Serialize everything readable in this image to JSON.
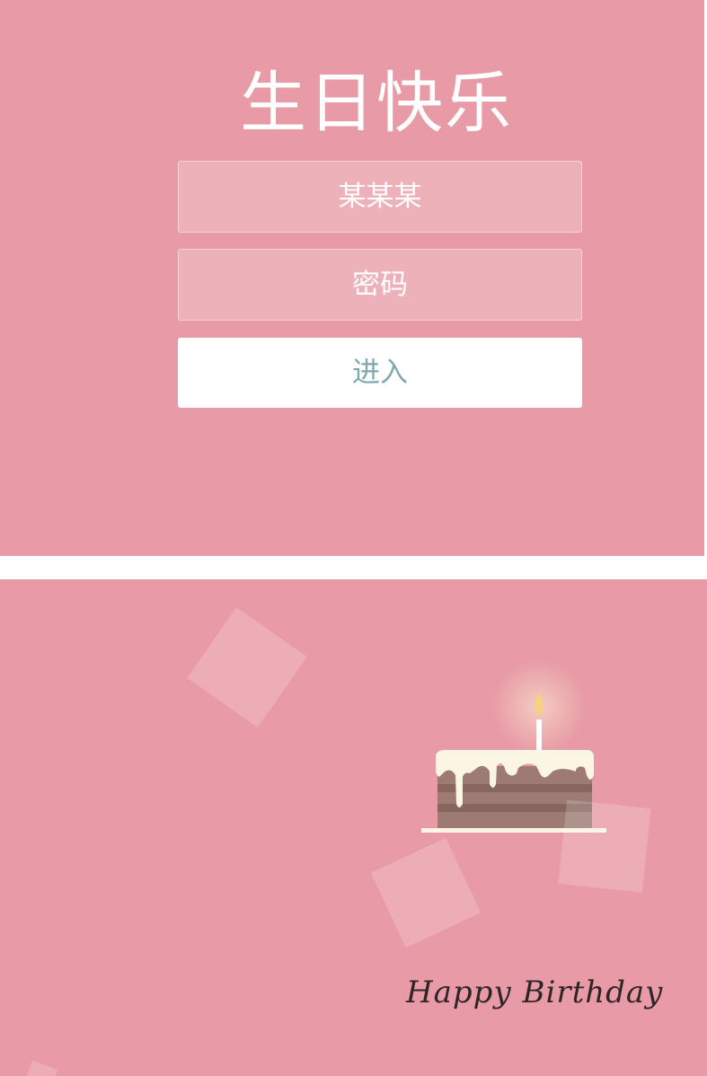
{
  "login": {
    "title": "生日快乐",
    "username_value": "某某某",
    "password_placeholder": "密码",
    "enter_button": "进入"
  },
  "card": {
    "signature": "Happy Birthday",
    "background_color": "#e89ba6",
    "decorations": [
      "cake-icon",
      "candle-icon",
      "confetti-square"
    ]
  }
}
